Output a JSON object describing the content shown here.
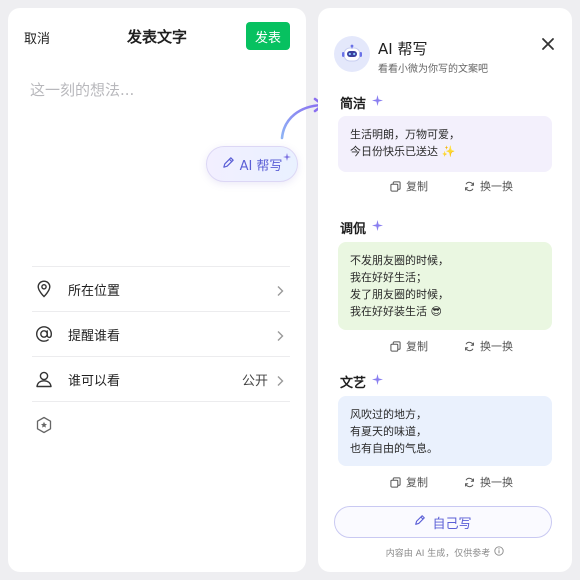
{
  "composer": {
    "cancel_label": "取消",
    "title": "发表文字",
    "publish_label": "发表",
    "placeholder": "这一刻的想法...",
    "ai_button_label": "AI 帮写",
    "options": [
      {
        "icon": "location-pin-icon",
        "label": "所在位置",
        "value": ""
      },
      {
        "icon": "at-sign-icon",
        "label": "提醒谁看",
        "value": ""
      },
      {
        "icon": "person-icon",
        "label": "谁可以看",
        "value": "公开"
      }
    ],
    "extra_icon": "badge-star-icon"
  },
  "ai_panel": {
    "title": "AI 帮写",
    "subtitle": "看看小微为你写的文案吧",
    "sections": [
      {
        "heading": "简洁",
        "lines": [
          "生活明朗，万物可爱，",
          "今日份快乐已送达 ✨"
        ],
        "color": "#f3f0fc"
      },
      {
        "heading": "调侃",
        "lines": [
          "不发朋友圈的时候，",
          "我在好好生活；",
          "发了朋友圈的时候，",
          "我在好好装生活 😎"
        ],
        "color": "#eaf7e1"
      },
      {
        "heading": "文艺",
        "lines": [
          "风吹过的地方，",
          "有夏天的味道，",
          "也有自由的气息。"
        ],
        "color": "#eaf1fd"
      }
    ],
    "copy_label": "复制",
    "swap_label": "换一换",
    "self_write_label": "自己写",
    "disclaimer": "内容由 AI 生成，仅供参考"
  },
  "colors": {
    "publish_green": "#07c160",
    "ai_accent": "#5b5fd6"
  }
}
